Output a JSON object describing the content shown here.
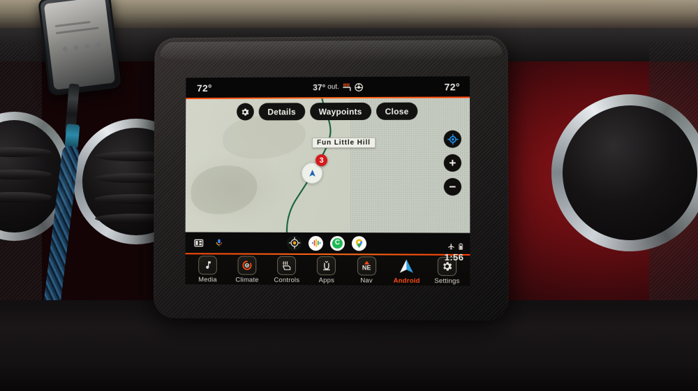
{
  "device": {
    "name": "uconnect-head-unit",
    "accent_color": "#ff4a0a"
  },
  "status_bar": {
    "temp_left": "72°",
    "outside_temp": "37°",
    "outside_label": "out.",
    "temp_right": "72°",
    "icons": [
      "heated-seat-icon",
      "heated-steering-wheel-icon"
    ]
  },
  "map": {
    "toolbar": {
      "settings_icon": "gear-icon",
      "buttons": [
        {
          "label": "Details",
          "name": "details-button"
        },
        {
          "label": "Waypoints",
          "name": "waypoints-button"
        },
        {
          "label": "Close",
          "name": "close-button"
        }
      ]
    },
    "place_label": "Fun  Little  Hill",
    "waypoint_badge": "3",
    "vehicle_marker": "navigation-arrow-icon",
    "controls": [
      {
        "name": "recenter-button",
        "glyph": "recenter-icon"
      },
      {
        "name": "zoom-in-button",
        "glyph": "+"
      },
      {
        "name": "zoom-out-button",
        "glyph": "−"
      }
    ]
  },
  "android_auto_bar": {
    "left_icons": [
      {
        "name": "split-screen-icon"
      },
      {
        "name": "assistant-mic-icon"
      }
    ],
    "apps": [
      {
        "name": "navigation-compass-app",
        "label": "Navigation"
      },
      {
        "name": "google-assistant-app",
        "label": "Assistant"
      },
      {
        "name": "phone-app",
        "label": "Phone"
      },
      {
        "name": "google-maps-app",
        "label": "Maps"
      }
    ]
  },
  "system_status": {
    "icons": [
      "airplane-mode-icon",
      "battery-icon"
    ],
    "clock": "1:56"
  },
  "bottom_bar": {
    "items": [
      {
        "label": "Media",
        "icon": "music-note-icon",
        "active": false
      },
      {
        "label": "Climate",
        "icon": "fan-icon",
        "active": false
      },
      {
        "label": "Controls",
        "icon": "vehicle-controls-icon",
        "active": false
      },
      {
        "label": "Apps",
        "icon": "uconnect-u-icon",
        "active": false
      },
      {
        "label": "Nav",
        "icon": "compass-ne-icon",
        "active": false,
        "heading": "NE"
      },
      {
        "label": "Android",
        "icon": "android-auto-icon",
        "active": true
      },
      {
        "label": "Settings",
        "icon": "gear-icon",
        "active": false
      }
    ]
  }
}
